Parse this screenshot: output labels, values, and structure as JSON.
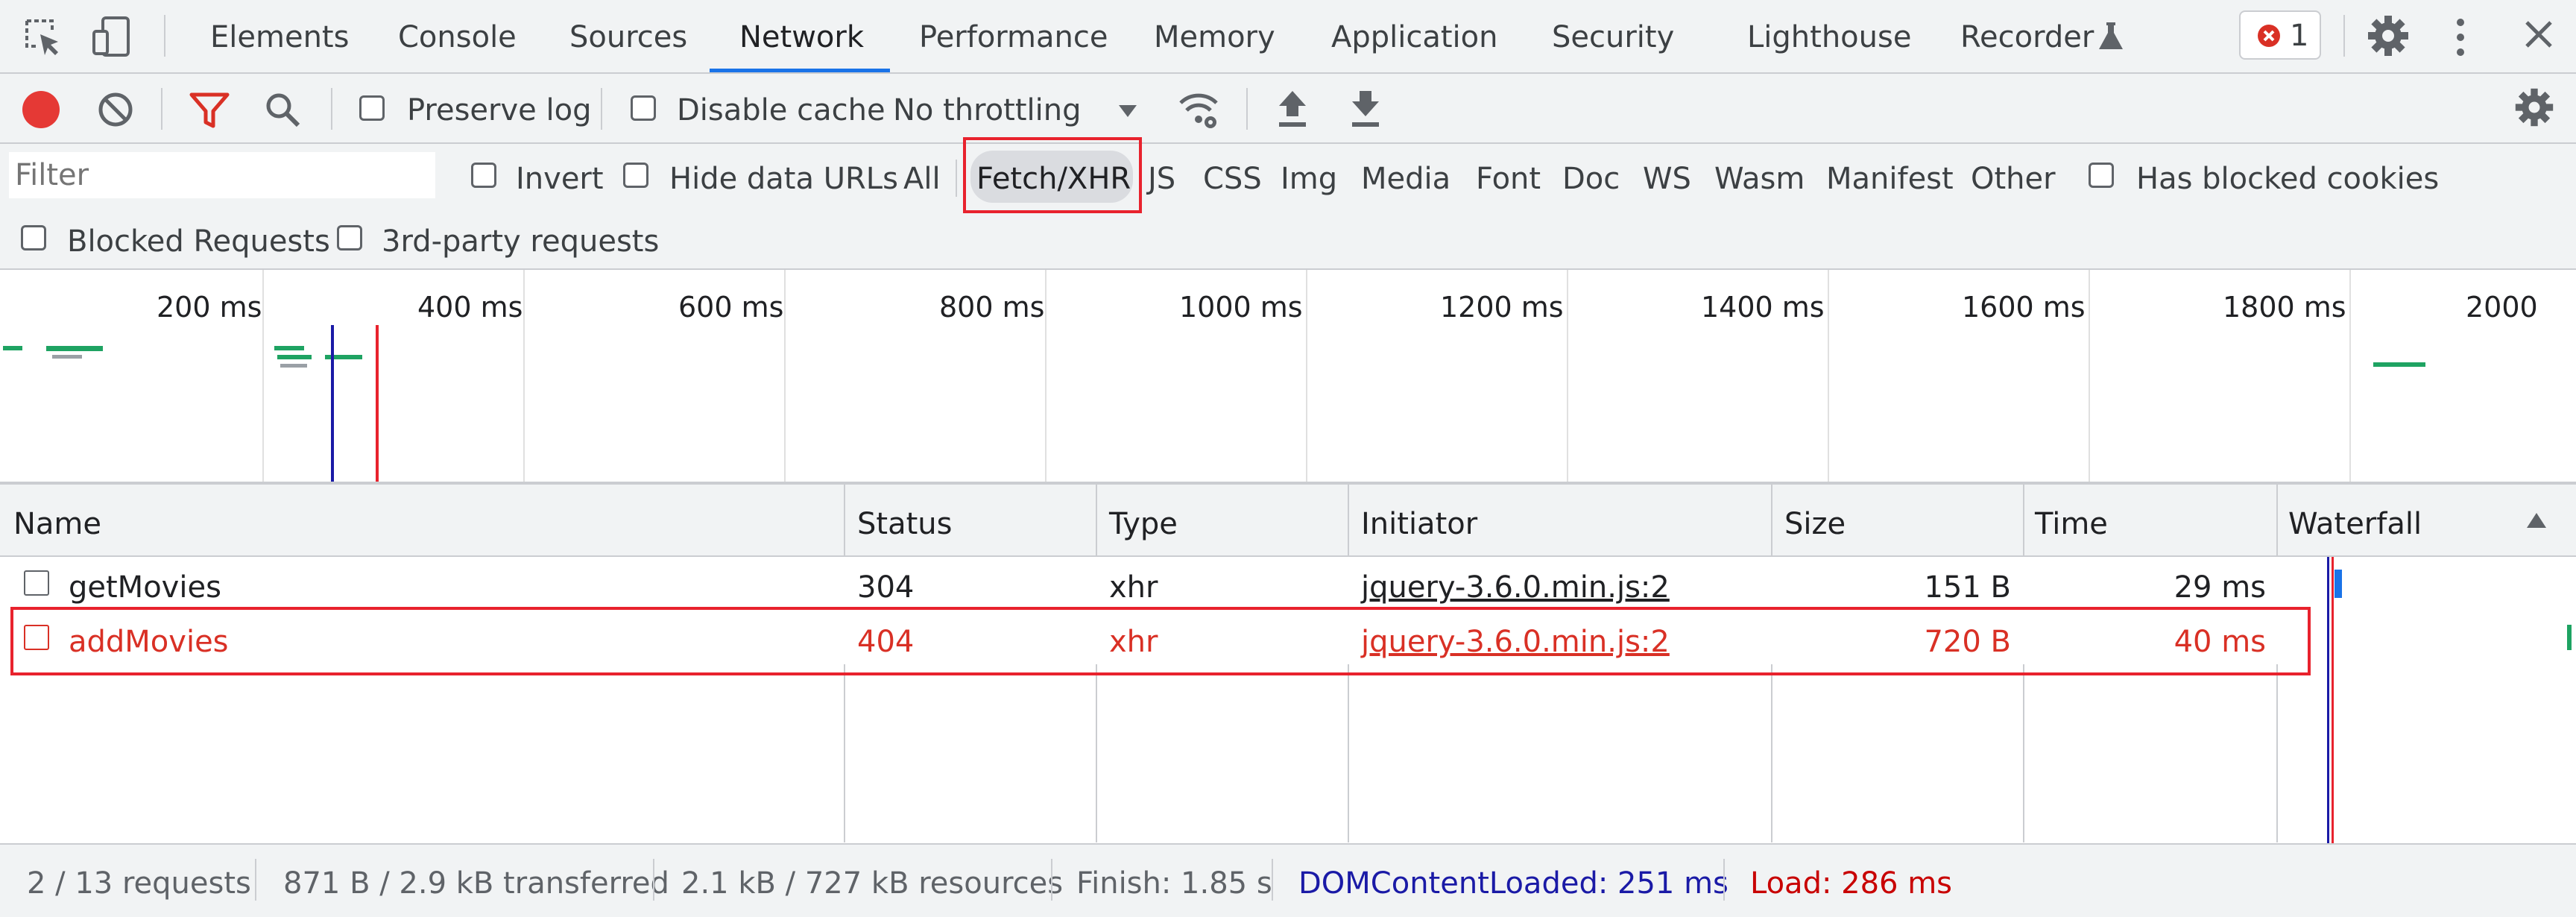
{
  "tabs": [
    "Elements",
    "Console",
    "Sources",
    "Network",
    "Performance",
    "Memory",
    "Application",
    "Security",
    "Lighthouse",
    "Recorder"
  ],
  "active_tab": "Network",
  "error_count": "1",
  "toolbar": {
    "preserve_log": "Preserve log",
    "disable_cache": "Disable cache",
    "throttling": "No throttling"
  },
  "filter": {
    "placeholder": "Filter",
    "invert": "Invert",
    "hide_data_urls": "Hide data URLs",
    "types": [
      "All",
      "Fetch/XHR",
      "JS",
      "CSS",
      "Img",
      "Media",
      "Font",
      "Doc",
      "WS",
      "Wasm",
      "Manifest",
      "Other"
    ],
    "active_type": "Fetch/XHR",
    "has_blocked_cookies": "Has blocked cookies",
    "blocked_requests": "Blocked Requests",
    "third_party": "3rd-party requests"
  },
  "timeline": {
    "ticks": [
      "200 ms",
      "400 ms",
      "600 ms",
      "800 ms",
      "1000 ms",
      "1200 ms",
      "1400 ms",
      "1600 ms",
      "1800 ms",
      "2000"
    ]
  },
  "table": {
    "columns": [
      "Name",
      "Status",
      "Type",
      "Initiator",
      "Size",
      "Time",
      "Waterfall"
    ],
    "rows": [
      {
        "name": "getMovies",
        "status": "304",
        "type": "xhr",
        "initiator": "jquery-3.6.0.min.js:2",
        "size": "151 B",
        "time": "29 ms",
        "error": false
      },
      {
        "name": "addMovies",
        "status": "404",
        "type": "xhr",
        "initiator": "jquery-3.6.0.min.js:2",
        "size": "720 B",
        "time": "40 ms",
        "error": true
      }
    ]
  },
  "status_bar": {
    "requests": "2 / 13 requests",
    "transferred": "871 B / 2.9 kB transferred",
    "resources": "2.1 kB / 727 kB resources",
    "finish": "Finish: 1.85 s",
    "dom_content_loaded": "DOMContentLoaded: 251 ms",
    "load": "Load: 286 ms"
  },
  "colors": {
    "accent": "#1a73e8",
    "error": "#d93025",
    "record": "#e53935",
    "dcl": "#1a1aa6",
    "load": "#c80000",
    "highlight": "#e8222d"
  }
}
